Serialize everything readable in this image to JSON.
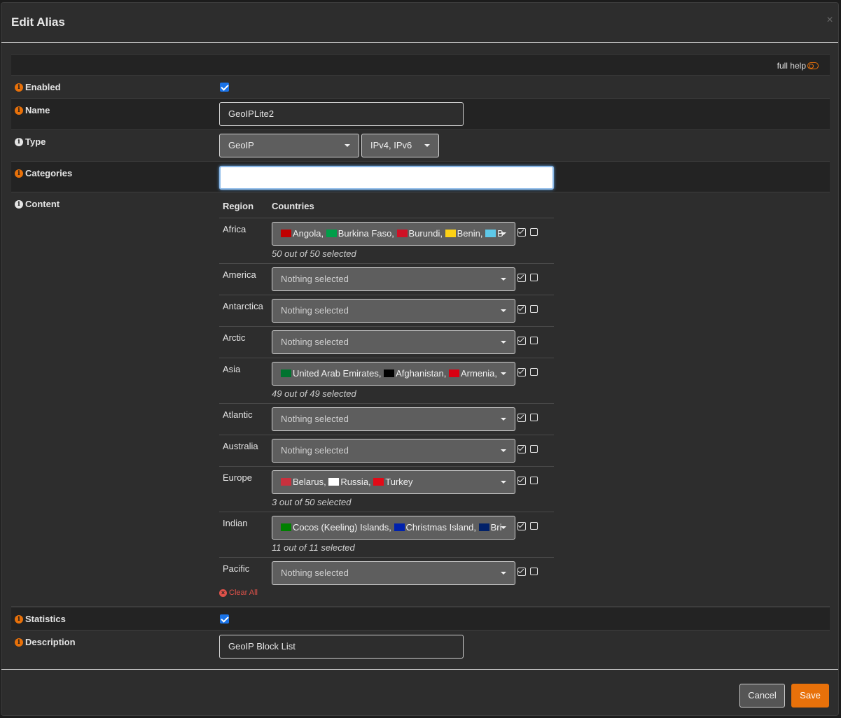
{
  "modal": {
    "title": "Edit Alias",
    "close_glyph": "×"
  },
  "help": {
    "full_help_label": "full help"
  },
  "fields": {
    "enabled": {
      "label": "Enabled",
      "checked": true
    },
    "name": {
      "label": "Name",
      "value": "GeoIPLite2"
    },
    "type": {
      "label": "Type",
      "value": "GeoIP",
      "protocol": "IPv4, IPv6"
    },
    "categories": {
      "label": "Categories",
      "value": ""
    },
    "content": {
      "label": "Content",
      "region_header": "Region",
      "countries_header": "Countries"
    },
    "statistics": {
      "label": "Statistics",
      "checked": true
    },
    "description": {
      "label": "Description",
      "value": "GeoIP Block List"
    }
  },
  "regions": [
    {
      "name": "Africa",
      "countries_text": "Angola, Burkina Faso, Burundi, Benin, B",
      "flags": [
        "#c00000",
        "#009e49",
        "#ce1126",
        "#fcd116",
        "#5ec8e8"
      ],
      "selected": "50 out of 50 selected"
    },
    {
      "name": "America",
      "countries_text": "Nothing selected",
      "flags": [],
      "selected": ""
    },
    {
      "name": "Antarctica",
      "countries_text": "Nothing selected",
      "flags": [],
      "selected": ""
    },
    {
      "name": "Arctic",
      "countries_text": "Nothing selected",
      "flags": [],
      "selected": ""
    },
    {
      "name": "Asia",
      "countries_text": "United Arab Emirates, Afghanistan, Armenia,",
      "flags": [
        "#00732f",
        "#000000",
        "#d90012"
      ],
      "selected": "49 out of 49 selected"
    },
    {
      "name": "Atlantic",
      "countries_text": "Nothing selected",
      "flags": [],
      "selected": ""
    },
    {
      "name": "Australia",
      "countries_text": "Nothing selected",
      "flags": [],
      "selected": ""
    },
    {
      "name": "Europe",
      "countries_text": "Belarus, Russia, Turkey",
      "flags": [
        "#c8313e",
        "#ffffff",
        "#e30a17"
      ],
      "selected": "3 out of 50 selected"
    },
    {
      "name": "Indian",
      "countries_text": "Cocos (Keeling) Islands, Christmas Island, Bri",
      "flags": [
        "#008000",
        "#0021ad",
        "#012169"
      ],
      "selected": "11 out of 11 selected"
    },
    {
      "name": "Pacific",
      "countries_text": "Nothing selected",
      "flags": [],
      "selected": ""
    }
  ],
  "clear_all_label": "Clear All",
  "footer": {
    "cancel_label": "Cancel",
    "save_label": "Save"
  },
  "colors": {
    "accent": "#e8710a",
    "checkbox": "#1a73e8",
    "danger": "#e0524a"
  }
}
